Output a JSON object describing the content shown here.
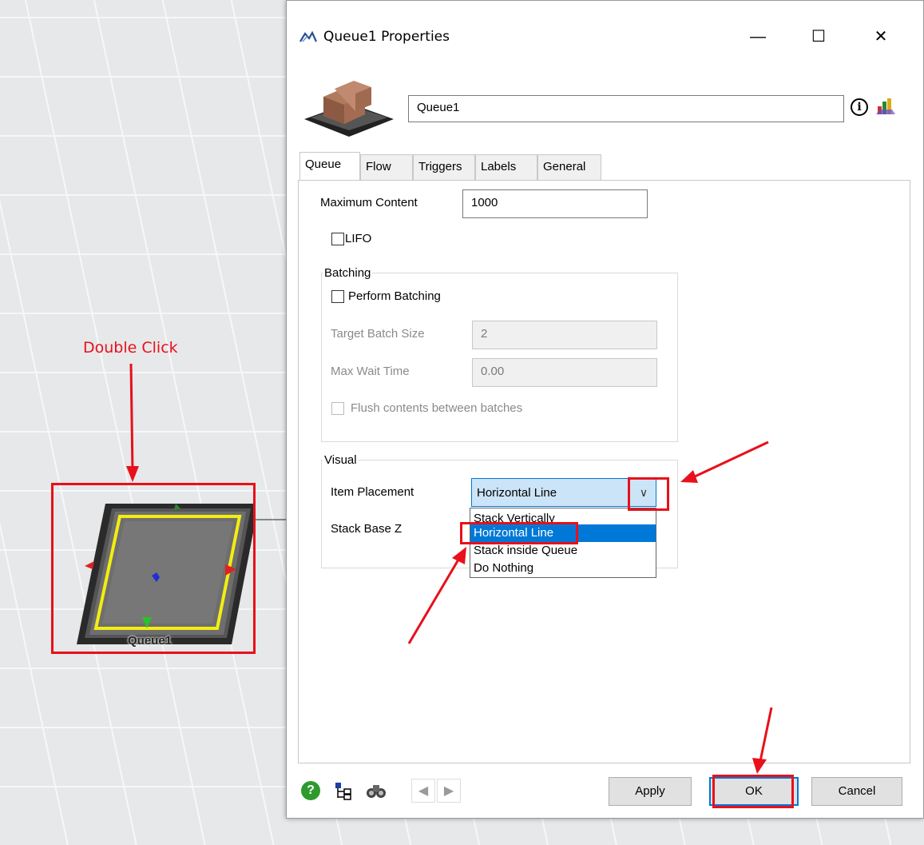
{
  "canvas": {
    "object_label": "Queue1",
    "annotation_double_click": "Double Click"
  },
  "dialog": {
    "title": "Queue1  Properties",
    "name_value": "Queue1",
    "tabs": [
      "Queue",
      "Flow",
      "Triggers",
      "Labels",
      "General"
    ],
    "max_content_label": "Maximum Content",
    "max_content_value": "1000",
    "lifo_label": "LIFO",
    "batching": {
      "group_title": "Batching",
      "perform_label": "Perform Batching",
      "target_label": "Target Batch Size",
      "target_value": "2",
      "wait_label": "Max Wait Time",
      "wait_value": "0.00",
      "flush_label": "Flush contents between batches"
    },
    "visual": {
      "group_title": "Visual",
      "placement_label": "Item Placement",
      "placement_value": "Horizontal Line",
      "base_z_label": "Stack Base Z",
      "options": [
        "Stack Vertically",
        "Horizontal Line",
        "Stack inside Queue",
        "Do Nothing"
      ]
    },
    "buttons": {
      "apply": "Apply",
      "ok": "OK",
      "cancel": "Cancel"
    },
    "window_controls": {
      "minimize": "—",
      "maximize": "☐",
      "close": "✕"
    }
  },
  "colors": {
    "annotation_red": "#e8101a",
    "select_blue": "#0078d7"
  }
}
